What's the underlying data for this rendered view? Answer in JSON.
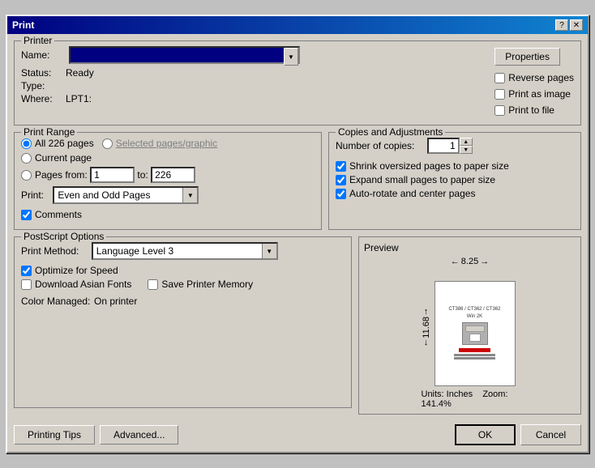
{
  "dialog": {
    "title": "Print",
    "title_btn_help": "?",
    "title_btn_close": "✕"
  },
  "printer_group": {
    "label": "Printer",
    "name_label": "Name:",
    "name_value": "",
    "properties_btn": "Properties",
    "status_label": "Status:",
    "status_value": "Ready",
    "type_label": "Type:",
    "type_value": "",
    "where_label": "Where:",
    "where_value": "LPT1:",
    "reverse_pages": "Reverse pages",
    "print_as_image": "Print as image",
    "print_to_file": "Print to file"
  },
  "print_range_group": {
    "label": "Print Range",
    "all_pages_label": "All 226 pages",
    "selected_label": "Selected pages/graphic",
    "current_page_label": "Current page",
    "pages_label": "Pages",
    "from_label": "from:",
    "from_value": "1",
    "to_label": "to:",
    "to_value": "226",
    "print_label": "Print:",
    "print_option": "Even and Odd Pages",
    "comments_label": "Comments"
  },
  "copies_group": {
    "label": "Copies and Adjustments",
    "num_copies_label": "Number of copies:",
    "num_copies_value": "1",
    "shrink_label": "Shrink oversized pages to paper size",
    "expand_label": "Expand small pages to paper size",
    "auto_rotate_label": "Auto-rotate and center pages"
  },
  "postscript_group": {
    "label": "PostScript Options",
    "print_method_label": "Print Method:",
    "print_method_value": "Language Level 3",
    "optimize_speed_label": "Optimize for Speed",
    "download_fonts_label": "Download Asian Fonts",
    "save_memory_label": "Save Printer Memory",
    "color_managed_label": "Color Managed:",
    "color_managed_value": "On printer"
  },
  "preview": {
    "label": "Preview",
    "width": "8.25",
    "height": "11.68",
    "units_label": "Units: Inches",
    "zoom_label": "Zoom: 141.4%",
    "page_lines": [
      "CT386 / CT362 / CT362",
      "Win 2K"
    ]
  },
  "bottom_buttons": {
    "printing_tips": "Printing Tips",
    "advanced": "Advanced...",
    "ok": "OK",
    "cancel": "Cancel"
  }
}
